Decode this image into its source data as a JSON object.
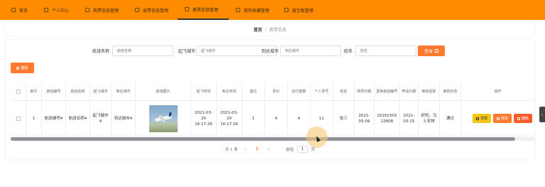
{
  "nav": {
    "items": [
      {
        "label": "首页",
        "icon": "home-icon"
      },
      {
        "label": "个人中心",
        "icon": "user-icon"
      },
      {
        "label": "购票信息管理",
        "icon": "ticket-icon"
      },
      {
        "label": "退票信息管理",
        "icon": "refund-icon"
      },
      {
        "label": "换票信息管理",
        "icon": "exchange-icon"
      },
      {
        "label": "我的收藏管理",
        "icon": "favorite-icon"
      },
      {
        "label": "留言板管理",
        "icon": "message-icon"
      }
    ],
    "active_index": 4
  },
  "breadcrumb": {
    "home": "首页",
    "separator": "/",
    "current": "换票信息"
  },
  "search": {
    "fields": [
      {
        "label": "航班名称",
        "placeholder": "航班名称"
      },
      {
        "label": "起飞城市",
        "placeholder": "起飞城市"
      },
      {
        "label": "到达城市",
        "placeholder": "到达城市"
      },
      {
        "label": "姓名",
        "placeholder": "姓名"
      }
    ],
    "query_label": "查询"
  },
  "toolbar": {
    "delete_label": "删除"
  },
  "table": {
    "headers": [
      "索引",
      "航班编号",
      "航班名称",
      "起飞城市",
      "到达城市",
      "航班图片",
      "起飞时间",
      "到达时间",
      "座位",
      "票价",
      "应付金额",
      "个人票号",
      "姓名",
      "购票日期",
      "更换航班编号",
      "申请日期",
      "审核回复",
      "审核状态",
      "操作"
    ],
    "rows": [
      {
        "index": "1",
        "flight_no": "航班编号4",
        "flight_name": "航班名称4",
        "from_city": "起飞城市4",
        "to_city": "到达城市4",
        "depart_time": "2021-03-20 16:17:26",
        "arrive_time": "2021-03-20 16:17:26",
        "seat": "1",
        "price": "4",
        "amount": "4",
        "ticket_no": "11",
        "name": "张三",
        "purchase_date": "2021-03-09",
        "new_flight_no": "1616230322808",
        "apply_date": "2021-03-15",
        "reply": "好的，马上安排",
        "status": "通过",
        "actions": {
          "detail": "详情",
          "edit": "修改",
          "delete": "删除"
        }
      }
    ]
  },
  "pagination": {
    "total": "共 1 条",
    "prev": "<",
    "current": "1",
    "next": ">",
    "goto": "前往",
    "page_value": "1",
    "page_suffix": "页"
  },
  "colors": {
    "nav_bg": "#ff8c00",
    "accent": "#ff7a2f",
    "detail": "#f5c518"
  }
}
